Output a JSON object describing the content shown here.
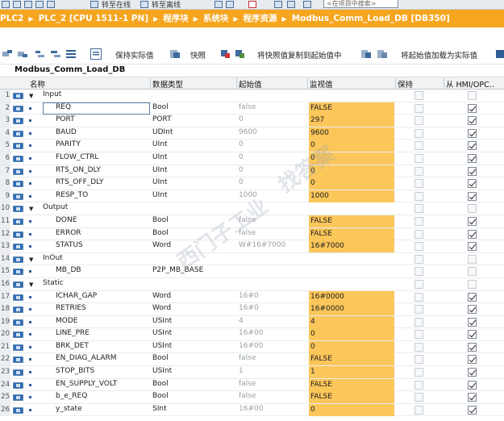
{
  "topbar": {
    "go_online": "转至在线",
    "go_offline": "转至离线",
    "search_placeholder": "<在项目中搜索>"
  },
  "breadcrumb": [
    "PLC2",
    "PLC_2 [CPU 1511-1 PN]",
    "程序块",
    "系统块",
    "程序资源",
    "Modbus_Comm_Load_DB [DB350]"
  ],
  "toolbar": {
    "keep_actual": "保持实际值",
    "snapshot": "快照",
    "copy_snapshot": "将快照值复制到起始值中",
    "load_start": "将起始值加载为实际值"
  },
  "db_title": "Modbus_Comm_Load_DB",
  "columns": {
    "name": "名称",
    "type": "数据类型",
    "init": "起始值",
    "monitor": "监视值",
    "retain": "保持",
    "hmi": "从 HMI/OPC.."
  },
  "rows": [
    {
      "no": "1",
      "level": 0,
      "section": true,
      "name": "Input",
      "type": "",
      "init": "",
      "mon": "",
      "hmi": false
    },
    {
      "no": "2",
      "level": 1,
      "name": "REQ",
      "type": "Bool",
      "init": "false",
      "mon": "FALSE",
      "hmi": true,
      "sel": true
    },
    {
      "no": "3",
      "level": 1,
      "name": "PORT",
      "type": "PORT",
      "init": "0",
      "mon": "297",
      "hmi": true
    },
    {
      "no": "4",
      "level": 1,
      "name": "BAUD",
      "type": "UDInt",
      "init": "9600",
      "mon": "9600",
      "hmi": true
    },
    {
      "no": "5",
      "level": 1,
      "name": "PARITY",
      "type": "UInt",
      "init": "0",
      "mon": "0",
      "hmi": true
    },
    {
      "no": "6",
      "level": 1,
      "name": "FLOW_CTRL",
      "type": "UInt",
      "init": "0",
      "mon": "0",
      "hmi": true
    },
    {
      "no": "7",
      "level": 1,
      "name": "RTS_ON_DLY",
      "type": "UInt",
      "init": "0",
      "mon": "0",
      "hmi": true
    },
    {
      "no": "8",
      "level": 1,
      "name": "RTS_OFF_DLY",
      "type": "UInt",
      "init": "0",
      "mon": "0",
      "hmi": true
    },
    {
      "no": "9",
      "level": 1,
      "name": "RESP_TO",
      "type": "UInt",
      "init": "1000",
      "mon": "1000",
      "hmi": true
    },
    {
      "no": "10",
      "level": 0,
      "section": true,
      "name": "Output",
      "type": "",
      "init": "",
      "mon": "",
      "hmi": false
    },
    {
      "no": "11",
      "level": 1,
      "name": "DONE",
      "type": "Bool",
      "init": "false",
      "mon": "FALSE",
      "hmi": true
    },
    {
      "no": "12",
      "level": 1,
      "name": "ERROR",
      "type": "Bool",
      "init": "false",
      "mon": "FALSE",
      "hmi": true
    },
    {
      "no": "13",
      "level": 1,
      "name": "STATUS",
      "type": "Word",
      "init": "W#16#7000",
      "mon": "16#7000",
      "hmi": true
    },
    {
      "no": "14",
      "level": 0,
      "section": true,
      "name": "InOut",
      "type": "",
      "init": "",
      "mon": "",
      "hmi": false
    },
    {
      "no": "15",
      "level": 1,
      "name": "MB_DB",
      "type": "P2P_MB_BASE",
      "init": "",
      "mon": "",
      "hmi": false
    },
    {
      "no": "16",
      "level": 0,
      "section": true,
      "name": "Static",
      "type": "",
      "init": "",
      "mon": "",
      "hmi": false
    },
    {
      "no": "17",
      "level": 1,
      "name": "ICHAR_GAP",
      "type": "Word",
      "init": "16#0",
      "mon": "16#0000",
      "hmi": true
    },
    {
      "no": "18",
      "level": 1,
      "name": "RETRIES",
      "type": "Word",
      "init": "16#0",
      "mon": "16#0000",
      "hmi": true
    },
    {
      "no": "19",
      "level": 1,
      "name": "MODE",
      "type": "USInt",
      "init": "4",
      "mon": "4",
      "hmi": true
    },
    {
      "no": "20",
      "level": 1,
      "name": "LINE_PRE",
      "type": "USInt",
      "init": "16#00",
      "mon": "0",
      "hmi": true
    },
    {
      "no": "21",
      "level": 1,
      "name": "BRK_DET",
      "type": "USInt",
      "init": "16#00",
      "mon": "0",
      "hmi": true
    },
    {
      "no": "22",
      "level": 1,
      "name": "EN_DIAG_ALARM",
      "type": "Bool",
      "init": "false",
      "mon": "FALSE",
      "hmi": true
    },
    {
      "no": "23",
      "level": 1,
      "name": "STOP_BITS",
      "type": "USInt",
      "init": "1",
      "mon": "1",
      "hmi": true
    },
    {
      "no": "24",
      "level": 1,
      "name": "EN_SUPPLY_VOLT",
      "type": "Bool",
      "init": "false",
      "mon": "FALSE",
      "hmi": true
    },
    {
      "no": "25",
      "level": 1,
      "name": "b_e_REQ",
      "type": "Bool",
      "init": "false",
      "mon": "FALSE",
      "hmi": true
    },
    {
      "no": "26",
      "level": 1,
      "name": "y_state",
      "type": "SInt",
      "init": "16#00",
      "mon": "0",
      "hmi": true
    }
  ],
  "colors": {
    "breadcrumb": "#f6a51e",
    "monitor_highlight": "#fbc65a"
  }
}
